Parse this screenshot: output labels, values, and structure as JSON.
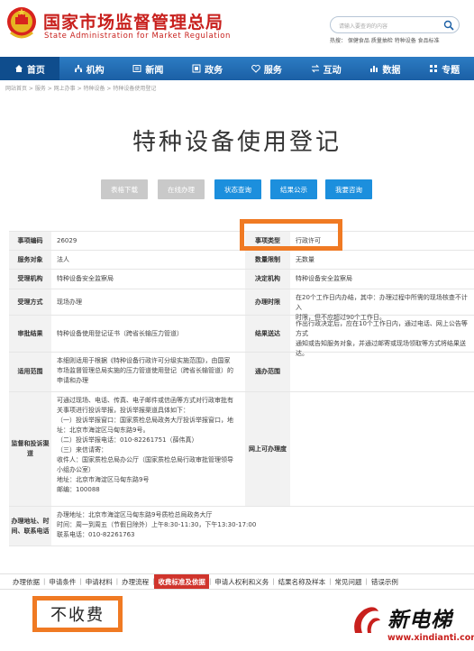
{
  "header": {
    "title_cn": "国家市场监督管理总局",
    "title_en": "State Administration for Market Regulation",
    "search_placeholder": "请输入要查询的内容",
    "hot_words": "热搜： 保健食品 质量抽检 特种设备 食品标准"
  },
  "nav": {
    "items": [
      {
        "label": "首页"
      },
      {
        "label": "机构"
      },
      {
        "label": "新闻"
      },
      {
        "label": "政务"
      },
      {
        "label": "服务"
      },
      {
        "label": "互动"
      },
      {
        "label": "数据"
      },
      {
        "label": "专题"
      }
    ]
  },
  "breadcrumb": "网站首页 > 服务 > 网上办事 > 特种设备 > 特种设备使用登记",
  "page_title": "特种设备使用登记",
  "buttons": {
    "b1": "表格下载",
    "b2": "在线办理",
    "b3": "状态查询",
    "b4": "结果公示",
    "b5": "我要咨询"
  },
  "table": {
    "r1": {
      "l1": "事项编码",
      "v1": "26029",
      "l2": "事项类型",
      "v2": "行政许可"
    },
    "r2": {
      "l1": "服务对象",
      "v1": "法人",
      "l2": "数量限制",
      "v2": "无数量"
    },
    "r3": {
      "l1": "受理机构",
      "v1": "特种设备安全监察局",
      "l2": "决定机构",
      "v2": "特种设备安全监察局"
    },
    "r4": {
      "l1": "受理方式",
      "v1": "现场办理",
      "l2": "办理时限",
      "v2_lines": [
        "在20个工作日内办结，其中：办理过程中所需的现场核查不计入",
        "时限，但不应超过90个工作日。"
      ]
    },
    "r5": {
      "l1": "审批结果",
      "v1": "特种设备使用登记证书（跨省长输压力管道）",
      "l2": "结果送达",
      "v2_lines": [
        "作出行政决定后，应在10个工作日内，通过电话、网上公告等方式",
        "通知或告知服务对象，并通过邮寄或现场领取等方式将结果送",
        "达。"
      ]
    },
    "r6": {
      "l1": "适用范围",
      "v1_lines": [
        "本细则适用于根据《特种设备行政许可分级实施范围》，由国家",
        "市场监督管理总局实施的压力管道使用登记（跨省长输管道）的",
        "申请和办理"
      ],
      "l2": "通办范围"
    },
    "r7": {
      "l1": "监督和投诉渠道",
      "v1_lines": [
        "可通过现场、电话、传真、电子邮件或信函等方式对行政审批有",
        "关事项进行投诉举报，投诉举报渠道具体如下：",
        "（一）投诉举报窗口：国家质检总局政务大厅投诉举报窗口，地",
        "址：北京市海淀区马甸东路9号。",
        "（二）投诉举报电话：010-82261751（薛伟真）",
        "（三）来信请寄：",
        "收件人：国家质检总局办公厅（国家质检总局行政审批管理领导",
        "小组办公室）",
        "地址：北京市海淀区马甸东路9号",
        "邮编：100088"
      ],
      "l2": "网上可办理度"
    },
    "r8": {
      "l1": "办理地址、时间、联系电话",
      "v1_lines": [
        "办理地址：北京市海淀区马甸东路9号质检总局政务大厅",
        "时间：周一到周五（节假日除外）上午8:30-11:30，下午13:30-17:00",
        "联系电话：010-82261763"
      ]
    }
  },
  "tabs": [
    "办理依据",
    "申请条件",
    "申请材料",
    "办理流程",
    "收费标准及依据",
    "申请人权利和义务",
    "结果名称及样本",
    "常见问题",
    "错误示例"
  ],
  "active_tab": "收费标准及依据",
  "fee": "不收费",
  "watermark": {
    "name": "新电梯",
    "url": "www.xindianti.com"
  },
  "colors": {
    "brand_red": "#c8201d",
    "nav_blue": "#1b5fa5",
    "button_blue": "#1c8fdd",
    "highlight_orange": "#f07a23",
    "tab_red": "#d0342c"
  }
}
